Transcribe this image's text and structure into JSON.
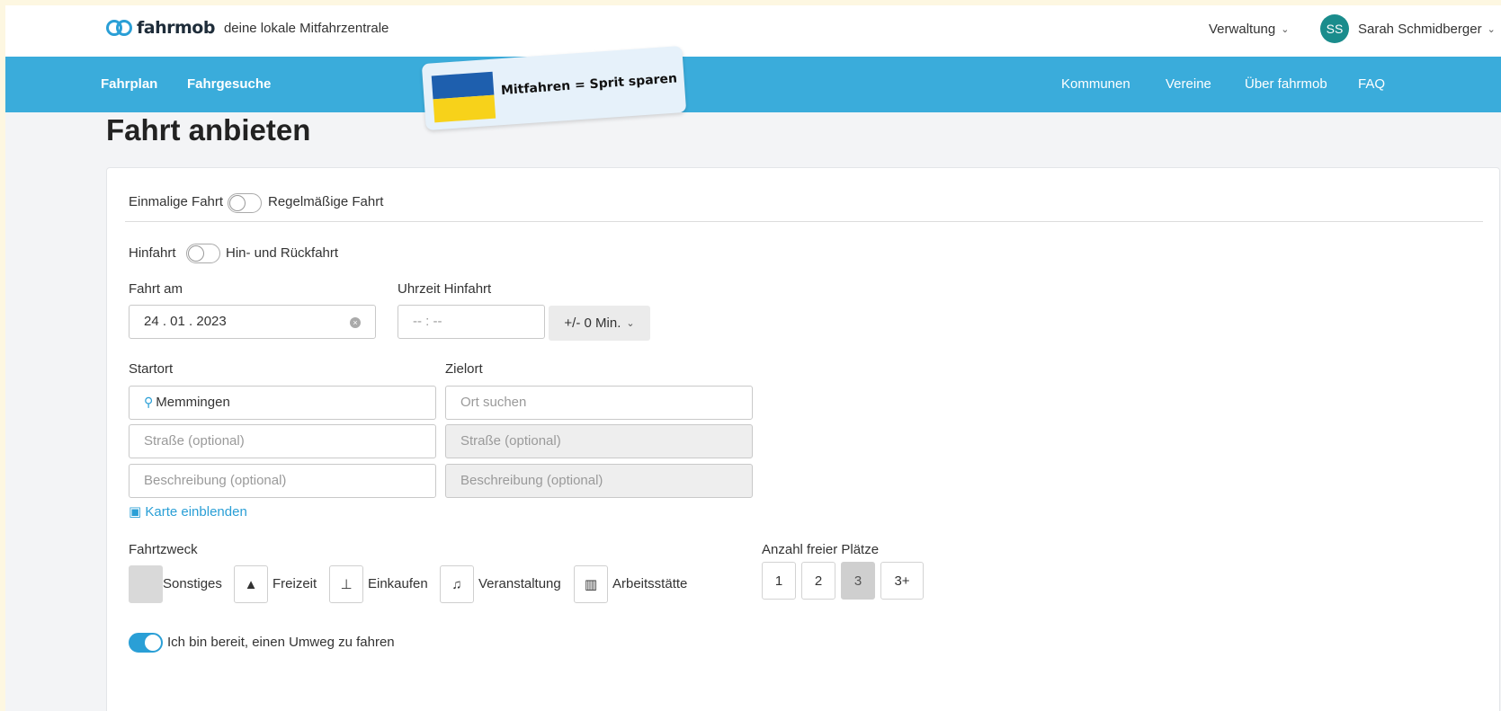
{
  "header": {
    "logo_text": "fahrmob",
    "tagline": "deine lokale Mitfahrzentrale",
    "admin_menu": "Verwaltung",
    "user_initials": "SS",
    "user_name": "Sarah Schmidberger"
  },
  "nav": {
    "left": [
      "Fahrplan",
      "Fahrgesuche"
    ],
    "banner_text": "Mitfahren = Sprit sparen",
    "right": [
      "Kommunen",
      "Vereine",
      "Über fahrmob",
      "FAQ"
    ]
  },
  "page_title": "Fahrt anbieten",
  "form": {
    "trip_type_left": "Einmalige Fahrt",
    "trip_type_right": "Regelmäßige Fahrt",
    "direction_left": "Hinfahrt",
    "direction_right": "Hin- und Rückfahrt",
    "date_label": "Fahrt am",
    "date_value": "24 . 01 . 2023",
    "time_label": "Uhrzeit Hinfahrt",
    "time_value": "-- : --",
    "tolerance": "+/- 0 Min.",
    "start_label": "Startort",
    "start_value": "Memmingen",
    "start_street_placeholder": "Straße (optional)",
    "start_desc_placeholder": "Beschreibung (optional)",
    "dest_label": "Zielort",
    "dest_placeholder": "Ort suchen",
    "dest_street_placeholder": "Straße (optional)",
    "dest_desc_placeholder": "Beschreibung (optional)",
    "map_link": "Karte einblenden",
    "purpose_label": "Fahrtzweck",
    "purposes": [
      {
        "label": "Sonstiges",
        "icon": "blank"
      },
      {
        "label": "Freizeit",
        "icon": "mountain-icon"
      },
      {
        "label": "Einkaufen",
        "icon": "cart-icon"
      },
      {
        "label": "Veranstaltung",
        "icon": "music-icon"
      },
      {
        "label": "Arbeitsstätte",
        "icon": "factory-icon"
      }
    ],
    "seats_label": "Anzahl freier Plätze",
    "seats": [
      "1",
      "2",
      "3",
      "3+"
    ],
    "selected_seat": "3",
    "detour_label": "Ich bin bereit, einen Umweg zu fahren"
  },
  "colors": {
    "brand": "#3aacdb",
    "avatar": "#1a8c8c",
    "link": "#2a9fd6"
  }
}
